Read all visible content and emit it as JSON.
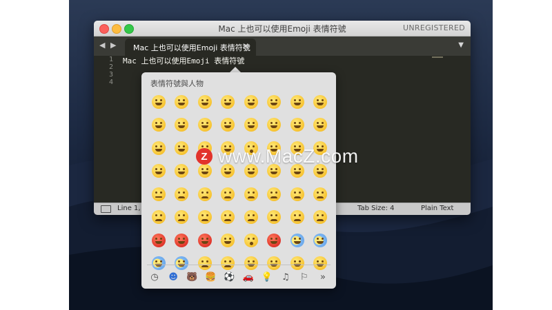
{
  "window": {
    "title": "Mac 上也可以使用Emoji 表情符號",
    "license": "UNREGISTERED"
  },
  "tabbar": {
    "nav_glyph": "◀ ▶",
    "tab_label": "Mac 上也可以使用Emoji 表情符號",
    "tab_close": "✕",
    "menu_glyph": "▼"
  },
  "editor": {
    "line_numbers": [
      "1",
      "2",
      "3",
      "4"
    ],
    "line1_text": "Mac 上也可以使用Emoji 表情符號"
  },
  "statusbar": {
    "position": "Line 1, C",
    "tab_size": "Tab Size: 4",
    "syntax": "Plain Text"
  },
  "emoji_picker": {
    "category_title": "表情符號與人物",
    "categories": [
      {
        "name": "recent",
        "glyph": "◷"
      },
      {
        "name": "smileys-people",
        "glyph": "☻"
      },
      {
        "name": "animals-nature",
        "glyph": "🐻"
      },
      {
        "name": "food-drink",
        "glyph": "🍔"
      },
      {
        "name": "activity",
        "glyph": "⚽"
      },
      {
        "name": "travel-places",
        "glyph": "🚗"
      },
      {
        "name": "objects",
        "glyph": "💡"
      },
      {
        "name": "symbols",
        "glyph": "♫"
      },
      {
        "name": "flags",
        "glyph": "⚐"
      },
      {
        "name": "more",
        "glyph": "»"
      }
    ]
  },
  "watermark": {
    "badge_letter": "Z",
    "text": "www.MacZ.com"
  }
}
